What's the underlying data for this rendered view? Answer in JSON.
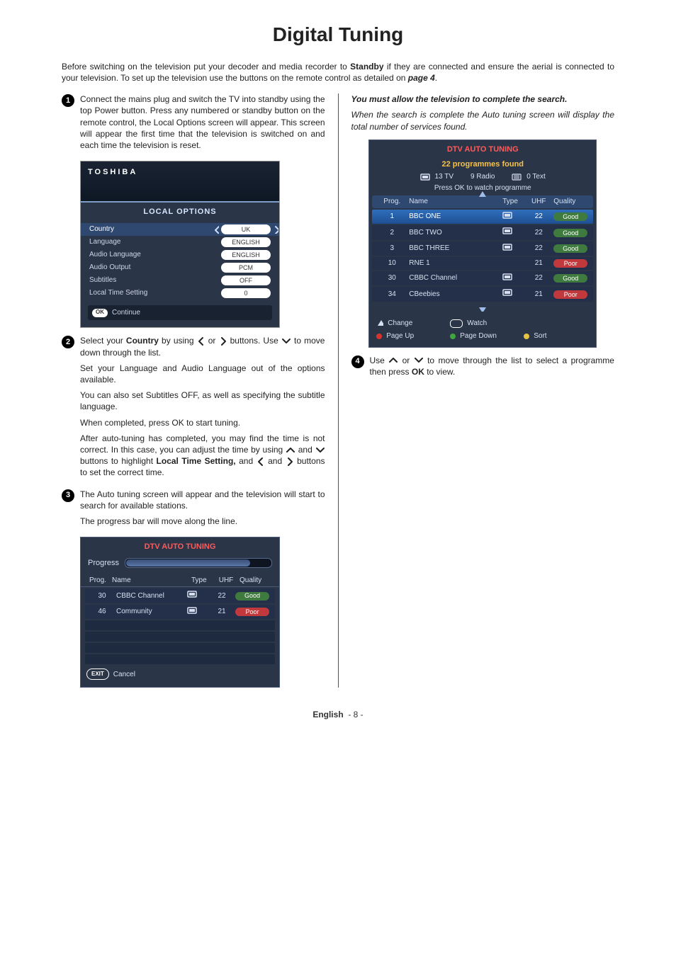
{
  "title": "Digital Tuning",
  "intro": {
    "pre": "Before switching on the television put your decoder and media recorder to ",
    "standby": "Standby",
    "mid": " if they are connected and ensure the aerial is connected to your television. To set up the television use the buttons on the remote control as detailed on ",
    "page_ref": "page 4",
    "post": "."
  },
  "steps": {
    "s1": {
      "num": "1",
      "text": "Connect the mains plug and switch the TV into standby using the top Power button. Press any numbered or standby button on the remote control, the Local Options screen will appear. This screen will appear the first time that the television is switched on and each time the television is reset."
    },
    "s2": {
      "num": "2",
      "p1_pre": "Select your ",
      "p1_country": "Country",
      "p1_mid": " by using ",
      "p1_or": " or ",
      "p1_post": " buttons. Use ",
      "p1_end": " to move down through the list.",
      "p2": "Set your Language and Audio Language out of the options available.",
      "p3": "You can also set Subtitles OFF, as well as specifying the subtitle language.",
      "p4": "When completed, press OK to start tuning.",
      "p5_pre": "After auto-tuning has completed, you may find the time is not correct. In this case, you can adjust the time by using ",
      "p5_mid": " and ",
      "p5_post": " buttons to highlight ",
      "p5_hi": "Local Time Setting,",
      "p5_and": " and ",
      "p5_and2": " and ",
      "p5_end": " buttons to set the correct time."
    },
    "s3": {
      "num": "3",
      "p1": "The Auto tuning screen will appear and the television will start to search for available stations.",
      "p2": "The progress bar will move along the line."
    },
    "s4": {
      "num": "4",
      "pre": "Use ",
      "mid": " or ",
      "post": " to move through the list to select a programme then press ",
      "ok": "OK",
      "end": " to view."
    }
  },
  "local_options": {
    "brand": "TOSHIBA",
    "title": "LOCAL OPTIONS",
    "rows": [
      {
        "label": "Country",
        "value": "UK",
        "selected": true
      },
      {
        "label": "Language",
        "value": "ENGLISH"
      },
      {
        "label": "Audio Language",
        "value": "ENGLISH"
      },
      {
        "label": "Audio Output",
        "value": "PCM"
      },
      {
        "label": "Subtitles",
        "value": "OFF"
      },
      {
        "label": "Local Time Setting",
        "value": "0"
      }
    ],
    "continue": "Continue",
    "ok": "OK"
  },
  "tuning_progress": {
    "title": "DTV AUTO TUNING",
    "progress_label": "Progress",
    "headers": {
      "prog": "Prog.",
      "name": "Name",
      "type": "Type",
      "uhf": "UHF",
      "quality": "Quality"
    },
    "rows": [
      {
        "prog": "30",
        "name": "CBBC Channel",
        "uhf": "22",
        "quality": "Good"
      },
      {
        "prog": "46",
        "name": "Community",
        "uhf": "21",
        "quality": "Poor"
      }
    ],
    "exit": "EXIT",
    "cancel": "Cancel"
  },
  "right": {
    "note1": "You must allow the television to complete the search.",
    "note2": "When the search is complete the Auto tuning screen will display the total number of services found."
  },
  "results": {
    "title": "DTV AUTO TUNING",
    "summary": "22 programmes found",
    "counts": {
      "tv": "13 TV",
      "radio": "9 Radio",
      "text": "0 Text"
    },
    "pressok": "Press OK to watch programme",
    "headers": {
      "prog": "Prog.",
      "name": "Name",
      "type": "Type",
      "uhf": "UHF",
      "quality": "Quality"
    },
    "rows": [
      {
        "prog": "1",
        "name": "BBC ONE",
        "uhf": "22",
        "quality": "Good",
        "hl": true
      },
      {
        "prog": "2",
        "name": "BBC TWO",
        "uhf": "22",
        "quality": "Good"
      },
      {
        "prog": "3",
        "name": "BBC THREE",
        "uhf": "22",
        "quality": "Good"
      },
      {
        "prog": "10",
        "name": "RNE 1",
        "uhf": "21",
        "quality": "Poor",
        "noicon": true
      },
      {
        "prog": "30",
        "name": "CBBC Channel",
        "uhf": "22",
        "quality": "Good"
      },
      {
        "prog": "34",
        "name": "CBeebies",
        "uhf": "21",
        "quality": "Poor"
      }
    ],
    "legend": {
      "change": "Change",
      "watch": "Watch",
      "pageup": "Page Up",
      "pagedown": "Page Down",
      "sort": "Sort"
    }
  },
  "footer": {
    "lang": "English",
    "page": "- 8 -"
  }
}
